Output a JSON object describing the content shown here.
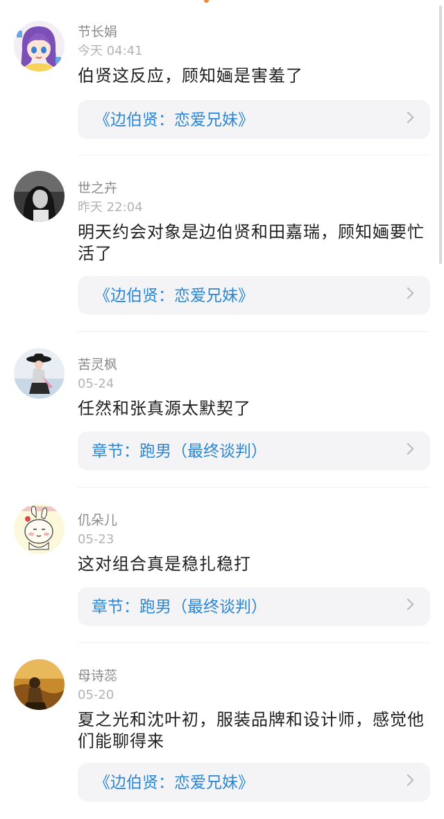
{
  "comments": [
    {
      "username": "节长娟",
      "time": "今天 04:41",
      "text": "伯贤这反应，顾知婳是害羞了",
      "link": "《边伯贤：恋爱兄妹》",
      "avatar_icon": "anime-girl-avatar"
    },
    {
      "username": "世之卉",
      "time": "昨天 22:04",
      "text": "明天约会对象是边伯贤和田嘉瑞，顾知婳要忙活了",
      "link": "《边伯贤：恋爱兄妹》",
      "avatar_icon": "bw-portrait-avatar"
    },
    {
      "username": "苦灵枫",
      "time": "05-24",
      "text": "任然和张真源太默契了",
      "link": "章节：跑男（最终谈判）",
      "avatar_icon": "woman-hat-avatar"
    },
    {
      "username": "仉朵儿",
      "time": "05-23",
      "text": "这对组合真是稳扎稳打",
      "link": "章节：跑男（最终谈判）",
      "avatar_icon": "cartoon-rabbit-avatar"
    },
    {
      "username": "母诗蕊",
      "time": "05-20",
      "text": "夏之光和沈叶初，服装品牌和设计师，感觉他们能聊得来",
      "link": "《边伯贤：恋爱兄妹》",
      "avatar_icon": "golden-field-avatar"
    }
  ],
  "colors": {
    "link": "#2a87d8",
    "username": "#8a8a8a",
    "time": "#b3b3b3",
    "card_bg": "#f4f4f6"
  }
}
